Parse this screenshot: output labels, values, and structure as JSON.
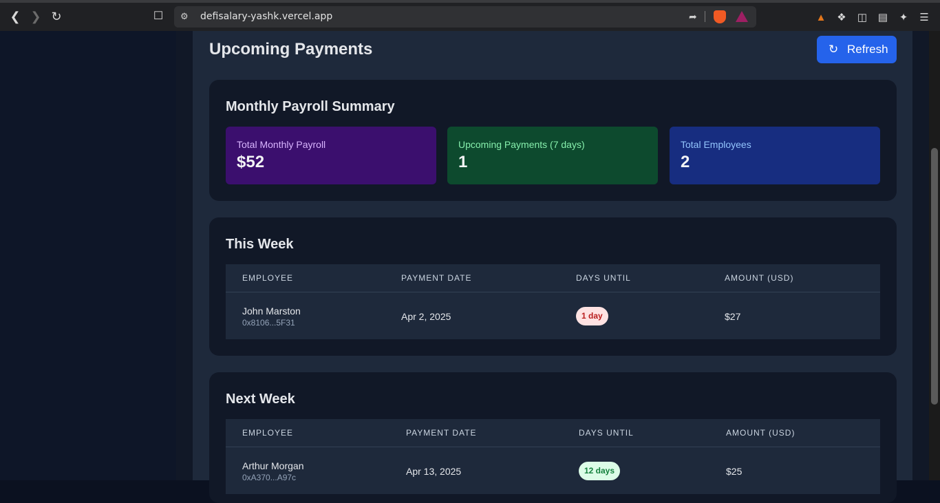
{
  "browser": {
    "url": "defisalary-yashk.vercel.app"
  },
  "page": {
    "title": "Upcoming Payments",
    "refresh_label": "Refresh"
  },
  "summary": {
    "title": "Monthly Payroll Summary",
    "stats": [
      {
        "label": "Total Monthly Payroll",
        "value": "$52",
        "bg": "#3b0f6e",
        "label_color": "#d8b4fe"
      },
      {
        "label": "Upcoming Payments (7 days)",
        "value": "1",
        "bg": "#0d4a2e",
        "label_color": "#86efac"
      },
      {
        "label": "Total Employees",
        "value": "2",
        "bg": "#172d80",
        "label_color": "#93c5fd"
      }
    ]
  },
  "this_week": {
    "title": "This Week",
    "headers": [
      "EMPLOYEE",
      "PAYMENT DATE",
      "DAYS UNTIL",
      "AMOUNT (USD)"
    ],
    "rows": [
      {
        "name": "John Marston",
        "address": "0x8106...5F31",
        "date": "Apr 2, 2025",
        "days": "1 day",
        "amount": "$27"
      }
    ]
  },
  "next_week": {
    "title": "Next Week",
    "headers": [
      "EMPLOYEE",
      "PAYMENT DATE",
      "DAYS UNTIL",
      "AMOUNT (USD)"
    ],
    "rows": [
      {
        "name": "Arthur Morgan",
        "address": "0xA370...A97c",
        "date": "Apr 13, 2025",
        "days": "12 days",
        "amount": "$25"
      }
    ]
  },
  "colors": {
    "accent": "#2563eb",
    "badge_urgent_bg": "#fee2e2",
    "badge_urgent_text": "#b91c1c",
    "badge_ok_bg": "#dcfce7",
    "badge_ok_text": "#15803d"
  }
}
